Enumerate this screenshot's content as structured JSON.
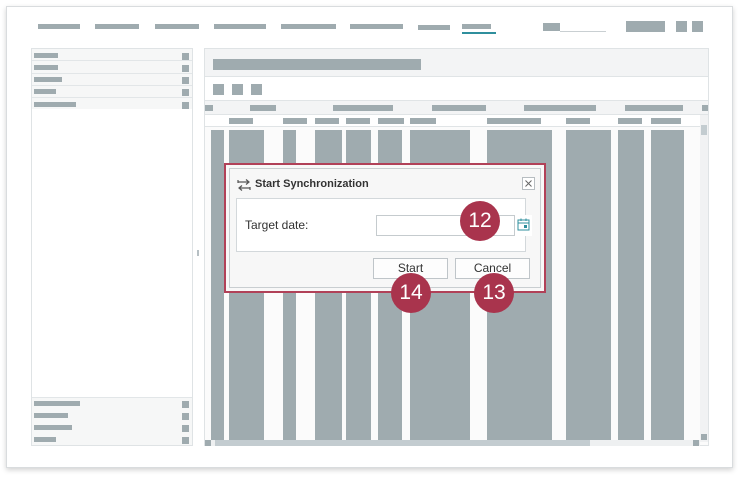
{
  "dialog": {
    "title": "Start Synchronization",
    "target_label": "Target date:",
    "target_value": "",
    "start_label": "Start",
    "cancel_label": "Cancel"
  },
  "callouts": {
    "c12": "12",
    "c13": "13",
    "c14": "14"
  },
  "colors": {
    "accent": "#b14158",
    "callout": "#a9344d",
    "placeholder_bar": "#9fabaf"
  }
}
